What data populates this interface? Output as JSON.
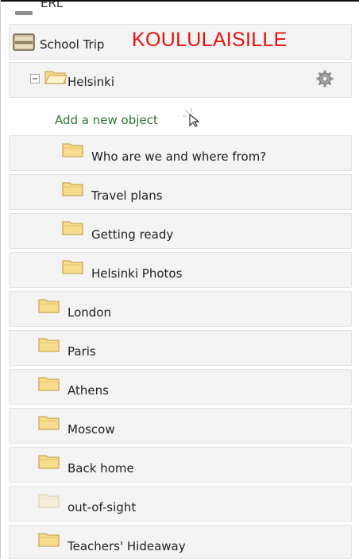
{
  "partial_row": {
    "label": "ERL"
  },
  "school_trip": {
    "label": "School Trip",
    "banner": "KOULULAISILLE"
  },
  "helsinki": {
    "label": "Helsinki",
    "add_object": "Add a new object"
  },
  "helsinki_children": [
    {
      "label": "Who are we and where from?"
    },
    {
      "label": "Travel plans"
    },
    {
      "label": "Getting ready"
    },
    {
      "label": "Helsinki Photos"
    }
  ],
  "folders": [
    {
      "label": "London"
    },
    {
      "label": "Paris"
    },
    {
      "label": "Athens"
    },
    {
      "label": "Moscow"
    },
    {
      "label": "Back home"
    },
    {
      "label": "out-of-sight"
    },
    {
      "label": "Teachers' Hideaway"
    }
  ],
  "icons": {
    "folder": "folder-icon",
    "faded_folder": "faded-folder-icon",
    "gear": "gear-icon",
    "collapse": "collapse-icon",
    "trip": "trip-icon",
    "cursor": "cursor-icon"
  },
  "colors": {
    "banner": "#e3120b",
    "link": "#2b7a32",
    "folder_fill": "#f6dc8c",
    "row_bg": "#f3f3f3"
  }
}
